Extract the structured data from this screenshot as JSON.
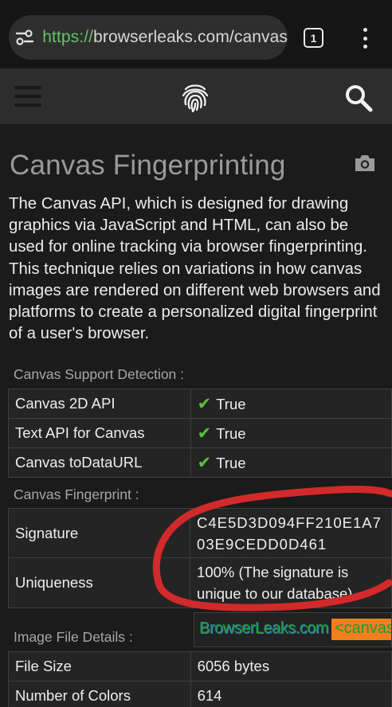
{
  "browser": {
    "url_scheme": "https://",
    "url_rest": "browserleaks.com/canvas",
    "tab_count": "1"
  },
  "page": {
    "title": "Canvas Fingerprinting",
    "intro": "The Canvas API, which is designed for drawing graphics via JavaScript and HTML, can also be used for online tracking via browser fingerprinting. This technique relies on variations in how canvas images are rendered on different web browsers and platforms to create a personalized digital fingerprint of a user's browser."
  },
  "support": {
    "label": "Canvas Support Detection :",
    "rows": [
      {
        "key": "Canvas 2D API",
        "value": "True"
      },
      {
        "key": "Text API for Canvas",
        "value": "True"
      },
      {
        "key": "Canvas toDataURL",
        "value": "True"
      }
    ],
    "check_color": "#5fbf3a"
  },
  "fingerprint": {
    "label": "Canvas Fingerprint :",
    "signature_key": "Signature",
    "signature_line1": "C4E5D3D094FF210E1A7",
    "signature_line2": "03E9CEDD0D461",
    "uniqueness_key": "Uniqueness",
    "uniqueness_line1": "100% (The signature is",
    "uniqueness_line2": "unique to our database)"
  },
  "image_details": {
    "label": "Image File Details :",
    "canvas_text": "BrowserLeaks.com",
    "canvas_text2": "<canvas",
    "rows": [
      {
        "key": "File Size",
        "value": "6056 bytes"
      },
      {
        "key": "Number of Colors",
        "value": "614"
      }
    ]
  },
  "colors": {
    "annotation": "#d22a2a",
    "url_scheme": "#63c46a"
  }
}
